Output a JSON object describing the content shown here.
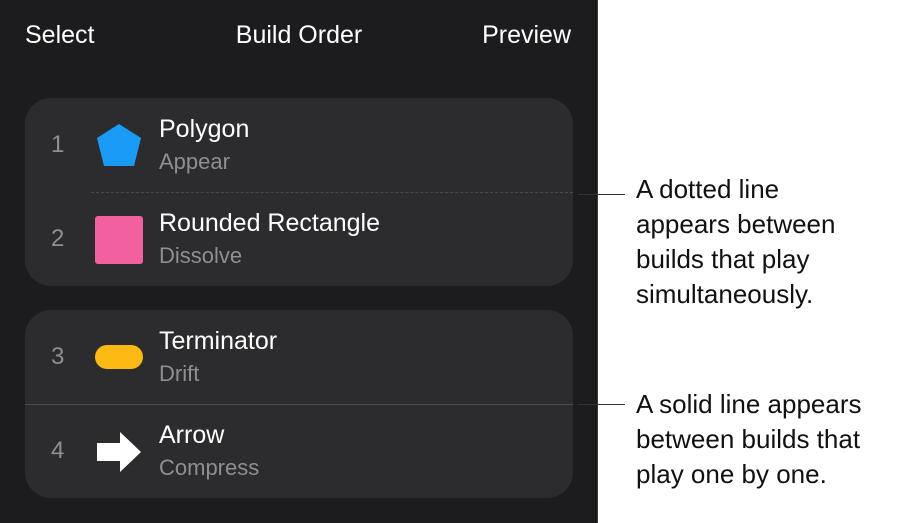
{
  "navbar": {
    "select_label": "Select",
    "title": "Build Order",
    "preview_label": "Preview"
  },
  "builds": [
    {
      "number": "1",
      "title": "Polygon",
      "subtitle": "Appear",
      "icon": "pentagon-icon",
      "color": "#1a9bf5"
    },
    {
      "number": "2",
      "title": "Rounded Rectangle",
      "subtitle": "Dissolve",
      "icon": "rounded-square-icon",
      "color": "#f2609f"
    },
    {
      "number": "3",
      "title": "Terminator",
      "subtitle": "Drift",
      "icon": "capsule-icon",
      "color": "#fdb913"
    },
    {
      "number": "4",
      "title": "Arrow",
      "subtitle": "Compress",
      "icon": "arrow-right-icon",
      "color": "#ffffff"
    }
  ],
  "callouts": {
    "dotted": [
      "A dotted line",
      "appears between",
      "builds that play",
      "simultaneously."
    ],
    "solid": [
      "A solid line appears",
      "between builds that",
      "play one by one."
    ]
  }
}
